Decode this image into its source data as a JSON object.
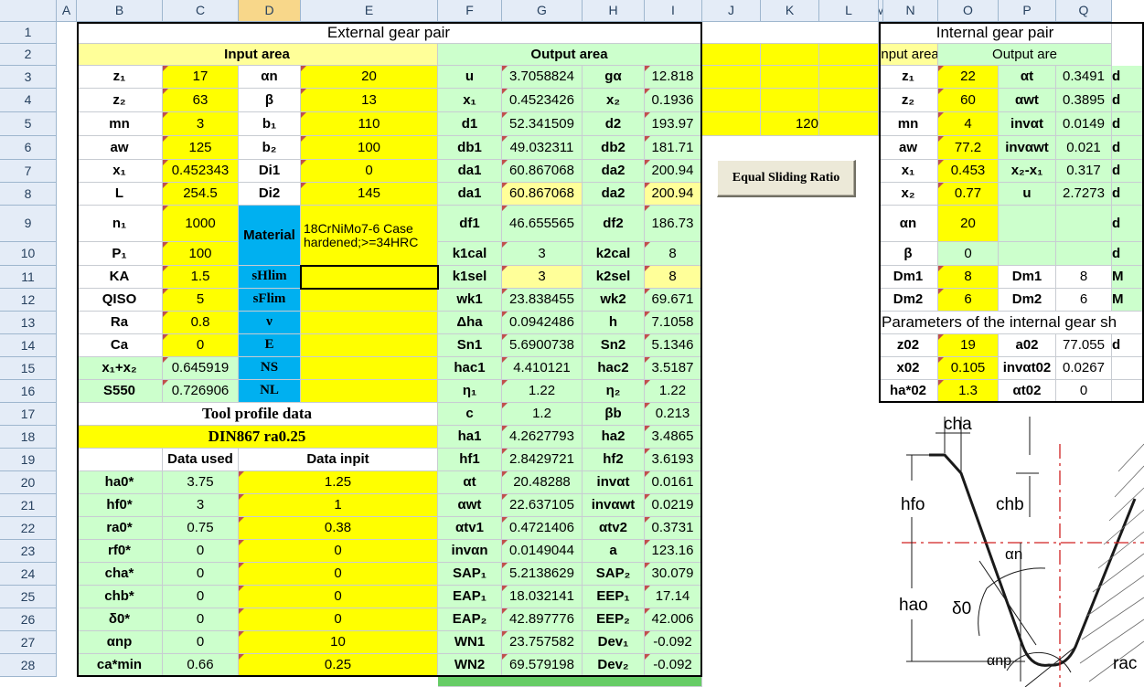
{
  "columns": [
    "A",
    "B",
    "C",
    "D",
    "E",
    "F",
    "G",
    "H",
    "I",
    "J",
    "K",
    "L",
    "M",
    "N",
    "O",
    "P",
    "Q"
  ],
  "rows": [
    "1",
    "2",
    "3",
    "4",
    "5",
    "6",
    "7",
    "8",
    "9",
    "10",
    "11",
    "12",
    "13",
    "14",
    "15",
    "16",
    "17",
    "18",
    "19",
    "20",
    "21",
    "22",
    "23",
    "24",
    "25",
    "26",
    "27",
    "28"
  ],
  "titles": {
    "external": "External gear pair",
    "internal": "Internal gear pair",
    "input_area": "Input area",
    "output_area": "Output area",
    "output_area_cut": "Output are",
    "tool_profile": "Tool profile data",
    "din": "DIN867 ra0.25",
    "data_used": "Data used",
    "data_input": "Data inpit",
    "params_internal": "Parameters of the internal gear sh"
  },
  "material": {
    "label": "Material",
    "value": "18CrNiMo7-6 Case hardened;>=34HRC"
  },
  "button": {
    "label": "Equal Sliding Ratio"
  },
  "j5_value": "120",
  "input_rows": [
    {
      "a": "z₁",
      "b": "17",
      "c": "αn",
      "d": "20"
    },
    {
      "a": "z₂",
      "b": "63",
      "c": "β",
      "d": "13"
    },
    {
      "a": "mn",
      "b": "3",
      "c": "b₁",
      "d": "110"
    },
    {
      "a": "aw",
      "b": "125",
      "c": "b₂",
      "d": "100"
    },
    {
      "a": "x₁",
      "b": "0.452343",
      "c": "Di1",
      "d": "0"
    },
    {
      "a": "L",
      "b": "254.5",
      "c": "Di2",
      "d": "145"
    },
    {
      "a": "n₁",
      "b": "1000"
    },
    {
      "a": "P₁",
      "b": "100"
    },
    {
      "a": "KA",
      "b": "1.5",
      "c": "sHlim",
      "d": ""
    },
    {
      "a": "QISO",
      "b": "5",
      "c": "sFlim",
      "d": ""
    },
    {
      "a": "Ra",
      "b": "0.8",
      "c": "ν",
      "d": ""
    },
    {
      "a": "Ca",
      "b": "0",
      "c": "E",
      "d": ""
    },
    {
      "a": "x₁+x₂",
      "b": "0.645919",
      "c": "NS",
      "d": ""
    },
    {
      "a": "S550",
      "b": "0.726906",
      "c": "NL",
      "d": ""
    }
  ],
  "tool_rows": [
    {
      "a": "ha0*",
      "b": "3.75",
      "d": "1.25"
    },
    {
      "a": "hf0*",
      "b": "3",
      "d": "1"
    },
    {
      "a": "ra0*",
      "b": "0.75",
      "d": "0.38"
    },
    {
      "a": "rf0*",
      "b": "0",
      "d": "0"
    },
    {
      "a": "cha*",
      "b": "0",
      "d": "0"
    },
    {
      "a": "chb*",
      "b": "0",
      "d": "0"
    },
    {
      "a": "δ0*",
      "b": "0",
      "d": "0"
    },
    {
      "a": "αnp",
      "b": "0",
      "d": "10"
    },
    {
      "a": "ca*min",
      "b": "0.66",
      "d": "0.25"
    }
  ],
  "output_rows": [
    {
      "e": "u",
      "f": "3.7058824",
      "g": "gα",
      "h": "12.818"
    },
    {
      "e": "x₁",
      "f": "0.4523426",
      "g": "x₂",
      "h": "0.1936"
    },
    {
      "e": "d1",
      "f": "52.341509",
      "g": "d2",
      "h": "193.97"
    },
    {
      "e": "db1",
      "f": "49.032311",
      "g": "db2",
      "h": "181.71"
    },
    {
      "e": "da1",
      "f": "60.867068",
      "g": "da2",
      "h": "200.94"
    },
    {
      "e": "da1",
      "f": "60.867068",
      "g": "da2",
      "h": "200.94"
    },
    {
      "e": "df1",
      "f": "46.655565",
      "g": "df2",
      "h": "186.73"
    },
    {
      "e": "k1cal",
      "f": "3",
      "g": "k2cal",
      "h": "8"
    },
    {
      "e": "k1sel",
      "f": "3",
      "g": "k2sel",
      "h": "8"
    },
    {
      "e": "wk1",
      "f": "23.838455",
      "g": "wk2",
      "h": "69.671"
    },
    {
      "e": "Δha",
      "f": "0.0942486",
      "g": "h",
      "h": "7.1058"
    },
    {
      "e": "Sn1",
      "f": "5.6900738",
      "g": "Sn2",
      "h": "5.1346"
    },
    {
      "e": "hac1",
      "f": "4.410121",
      "g": "hac2",
      "h": "3.5187"
    },
    {
      "e": "η₁",
      "f": "1.22",
      "g": "η₂",
      "h": "1.22"
    },
    {
      "e": "c",
      "f": "1.2",
      "g": "βb",
      "h": "0.213"
    },
    {
      "e": "ha1",
      "f": "4.2627793",
      "g": "ha2",
      "h": "3.4865"
    },
    {
      "e": "hf1",
      "f": "2.8429721",
      "g": "hf2",
      "h": "3.6193"
    },
    {
      "e": "αt",
      "f": "20.48288",
      "g": "invαt",
      "h": "0.0161"
    },
    {
      "e": "αwt",
      "f": "22.637105",
      "g": "invαwt",
      "h": "0.0219"
    },
    {
      "e": "αtv1",
      "f": "0.4721406",
      "g": "αtv2",
      "h": "0.3731"
    },
    {
      "e": "invαn",
      "f": "0.0149044",
      "g": "a",
      "h": "123.16"
    },
    {
      "e": "SAP₁",
      "f": "5.2138629",
      "g": "SAP₂",
      "h": "30.079"
    },
    {
      "e": "EAP₁",
      "f": "18.032141",
      "g": "EEP₁",
      "h": "17.14"
    },
    {
      "e": "EAP₂",
      "f": "42.897776",
      "g": "EEP₂",
      "h": "42.006"
    },
    {
      "e": "WN1",
      "f": "23.757582",
      "g": "Dev₁",
      "h": "-0.092"
    },
    {
      "e": "WN2",
      "f": "69.579198",
      "g": "Dev₂",
      "h": "-0.092"
    }
  ],
  "internal_rows": [
    {
      "m": "z₁",
      "n": "22",
      "o": "αt",
      "p": "0.3491",
      "q": "d"
    },
    {
      "m": "z₂",
      "n": "60",
      "o": "αwt",
      "p": "0.3895",
      "q": "d"
    },
    {
      "m": "mn",
      "n": "4",
      "o": "invαt",
      "p": "0.0149",
      "q": "d"
    },
    {
      "m": "aw",
      "n": "77.2",
      "o": "invαwt",
      "p": "0.021",
      "q": "d"
    },
    {
      "m": "x₁",
      "n": "0.453",
      "o": "x₂-x₁",
      "p": "0.317",
      "q": "d"
    },
    {
      "m": "x₂",
      "n": "0.77",
      "o": "u",
      "p": "2.7273",
      "q": "d"
    },
    {
      "m": "αn",
      "n": "20",
      "o": "",
      "p": "",
      "q": "d"
    },
    {
      "m": "β",
      "n": "0",
      "o": "",
      "p": "",
      "q": "d"
    },
    {
      "m": "Dm1",
      "n": "8",
      "o": "Dm1",
      "p": "8",
      "q": "M"
    },
    {
      "m": "Dm2",
      "n": "6",
      "o": "Dm2",
      "p": "6",
      "q": "M"
    }
  ],
  "internal_shaper_rows": [
    {
      "m": "z02",
      "n": "19",
      "o": "a02",
      "p": "77.055",
      "q": "d"
    },
    {
      "m": "x02",
      "n": "0.105",
      "o": "invαt02",
      "p": "0.0267",
      "q": ""
    },
    {
      "m": "ha*02",
      "n": "1.3",
      "o": "αt02",
      "p": "0",
      "q": ""
    }
  ],
  "diagram_labels": {
    "cha": "cha",
    "chb": "chb",
    "hfo": "hfo",
    "hao": "hao",
    "an": "αn",
    "d0": "δ0",
    "anp": "αnp",
    "ra": "rac"
  },
  "colors": {
    "input_yellow": "#ffff00",
    "output_green": "#ccffcc",
    "material_blue": "#00b0f0",
    "light_yellow": "#ffff99",
    "header_blue": "#e4ecf7"
  }
}
